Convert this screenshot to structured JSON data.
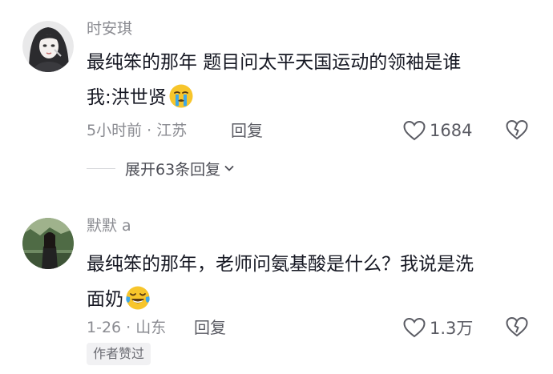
{
  "comments": [
    {
      "username": "时安琪",
      "lines": [
        "最纯笨的那年  题目问太平天国运动的领袖是谁",
        "我:洪世贤"
      ],
      "emoji": "crying-face-emoji",
      "meta": "5小时前 · 江苏",
      "reply_label": "回复",
      "like_count": "1684",
      "expand_label": "展开63条回复"
    },
    {
      "username": "默默 a",
      "lines": [
        "最纯笨的那年，老师问氨基酸是什么？我说是洗",
        "面奶"
      ],
      "emoji": "laughing-tears-emoji",
      "meta": "1-26 · 山东",
      "reply_label": "回复",
      "like_count": "1.3万",
      "badge": "作者赞过"
    }
  ],
  "colors": {
    "text_primary": "#161823",
    "text_secondary": "#8a8b91",
    "icon": "#5a5b63",
    "emoji_yellow": "#f7c52b",
    "tear_blue": "#3fa7e8"
  }
}
